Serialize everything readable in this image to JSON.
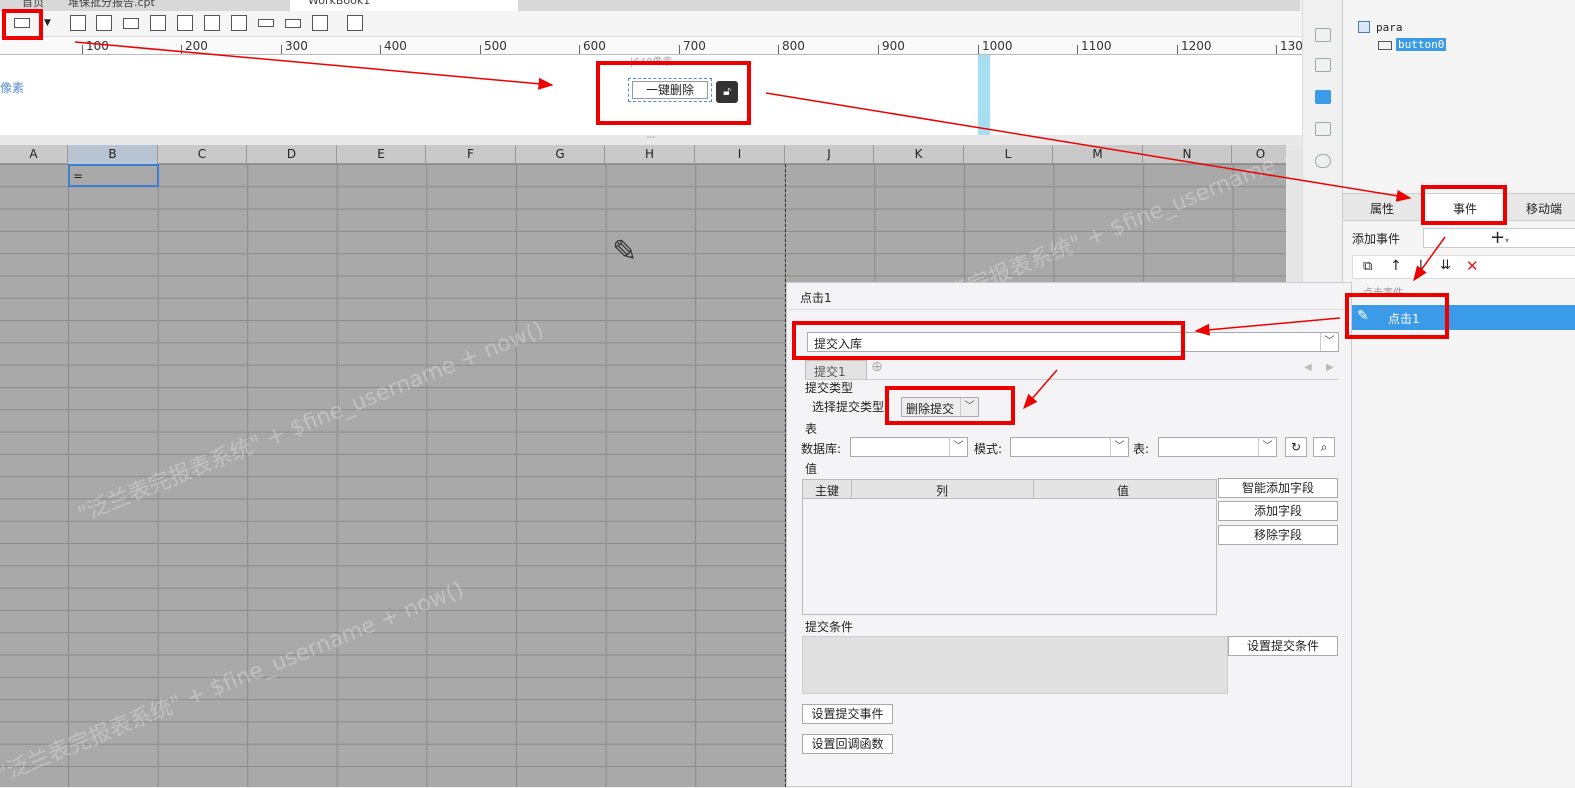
{
  "tabs": [
    {
      "label": "首页"
    },
    {
      "label": "堆保批分报告.cpt"
    },
    {
      "label": "WorkBook1"
    }
  ],
  "ruler": {
    "ticks": [
      "100",
      "200",
      "300",
      "400",
      "500",
      "600",
      "700",
      "800",
      "900",
      "1000",
      "1100",
      "1200",
      "130"
    ]
  },
  "param_area": {
    "left_label": "像素",
    "width_hint": "|648像素",
    "button_text": "一键删除",
    "dots": "⋯"
  },
  "columns": [
    "A",
    "B",
    "C",
    "D",
    "E",
    "F",
    "G",
    "H",
    "I",
    "J",
    "K",
    "L",
    "M",
    "N",
    "O"
  ],
  "cell_b1": "=",
  "watermark_text": "\"泛兰表完报表系统\" + $fine_username + now()",
  "right_panel": {
    "tree_root": "para",
    "tree_child": "button0",
    "tabs": [
      "属性",
      "事件",
      "移动端"
    ],
    "add_event_label": "添加事件",
    "add_symbol": "+",
    "event_group": "点击事件",
    "event_item": "点击1"
  },
  "dialog": {
    "title": "点击1",
    "action_select": "提交入库",
    "sub_tab": "提交1",
    "section_type": "提交类型",
    "select_type_label": "选择提交类型",
    "type_value": "删除提交",
    "section_table": "表",
    "db_label": "数据库:",
    "schema_label": "模式:",
    "table_label": "表:",
    "section_value": "值",
    "table_headers": [
      "主键",
      "列",
      "值"
    ],
    "btn_smart_add": "智能添加字段",
    "btn_add": "添加字段",
    "btn_remove": "移除字段",
    "section_condition": "提交条件",
    "btn_set_condition": "设置提交条件",
    "btn_set_event": "设置提交事件",
    "btn_set_callback": "设置回调函数"
  },
  "colors": {
    "accent": "#3c9be8",
    "annotation": "#ee0000",
    "grid": "#a9a9a9"
  }
}
